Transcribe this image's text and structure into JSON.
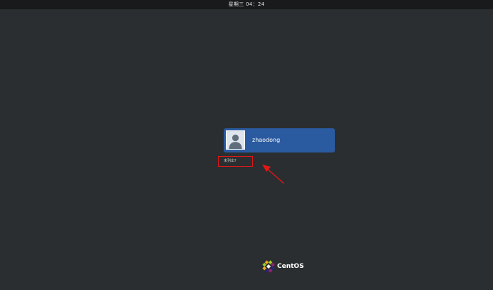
{
  "top_bar": {
    "clock": "星期三 04：24"
  },
  "login": {
    "users": [
      {
        "name": "zhaodong",
        "avatar_icon": "user-icon"
      }
    ],
    "not_listed_label": "未列出？"
  },
  "branding": {
    "logo_text": "CentOS",
    "logo_icon": "centos-logo-icon"
  },
  "annotation": {
    "highlight_color": "#e01818",
    "arrow_icon": "red-arrow-icon"
  },
  "colors": {
    "background": "#2b2e30",
    "user_card": "#2a5a9f",
    "top_bar": "#191a1b"
  }
}
